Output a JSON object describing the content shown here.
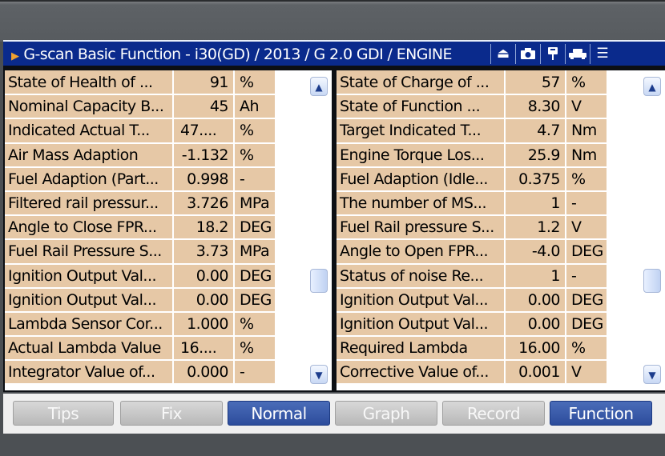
{
  "title": "G-scan Basic Function - i30(GD) / 2013 / G 2.0 GDI / ENGINE",
  "toolbar_icons": [
    "eject-icon",
    "camera-icon",
    "flag-icon",
    "car-icon",
    "menu-icon"
  ],
  "left_rows": [
    {
      "name": "State of Health of ...",
      "value": "91",
      "unit": "%"
    },
    {
      "name": "Nominal Capacity B...",
      "value": "45",
      "unit": "Ah"
    },
    {
      "name": "Indicated Actual T...",
      "value": "47....",
      "unit": "%"
    },
    {
      "name": "Air Mass Adaption",
      "value": "-1.132",
      "unit": "%"
    },
    {
      "name": "Fuel Adaption (Part...",
      "value": "0.998",
      "unit": "-"
    },
    {
      "name": "Filtered rail pressur...",
      "value": "3.726",
      "unit": "MPa"
    },
    {
      "name": "Angle to Close FPR...",
      "value": "18.2",
      "unit": "DEG"
    },
    {
      "name": "Fuel Rail Pressure S...",
      "value": "3.73",
      "unit": "MPa"
    },
    {
      "name": "Ignition Output Val...",
      "value": "0.00",
      "unit": "DEG"
    },
    {
      "name": "Ignition Output Val...",
      "value": "0.00",
      "unit": "DEG"
    },
    {
      "name": "Lambda Sensor Cor...",
      "value": "1.000",
      "unit": "%"
    },
    {
      "name": "Actual Lambda Value",
      "value": "16....",
      "unit": "%"
    },
    {
      "name": "Integrator Value of...",
      "value": "0.000",
      "unit": "-"
    }
  ],
  "right_rows": [
    {
      "name": "State of Charge of ...",
      "value": "57",
      "unit": "%"
    },
    {
      "name": "State of Function ...",
      "value": "8.30",
      "unit": "V"
    },
    {
      "name": "Target Indicated T...",
      "value": "4.7",
      "unit": "Nm"
    },
    {
      "name": "Engine Torque Los...",
      "value": "25.9",
      "unit": "Nm"
    },
    {
      "name": "Fuel Adaption (Idle...",
      "value": "0.375",
      "unit": "%"
    },
    {
      "name": "The number of MS...",
      "value": "1",
      "unit": "-"
    },
    {
      "name": "Fuel Rail pressure S...",
      "value": "1.2",
      "unit": "V"
    },
    {
      "name": "Angle to Open FPR...",
      "value": "-4.0",
      "unit": "DEG"
    },
    {
      "name": "Status of noise Re...",
      "value": "1",
      "unit": "-"
    },
    {
      "name": "Ignition Output Val...",
      "value": "0.00",
      "unit": "DEG"
    },
    {
      "name": "Ignition Output Val...",
      "value": "0.00",
      "unit": "DEG"
    },
    {
      "name": "Required Lambda",
      "value": "16.00",
      "unit": "%"
    },
    {
      "name": "Corrective Value of...",
      "value": "0.001",
      "unit": "V"
    }
  ],
  "bottom_buttons": [
    {
      "label": "Tips",
      "active": false
    },
    {
      "label": "Fix",
      "active": false
    },
    {
      "label": "Normal",
      "active": true
    },
    {
      "label": "Graph",
      "active": false
    },
    {
      "label": "Record",
      "active": false
    },
    {
      "label": "Function",
      "active": true
    }
  ],
  "colors": {
    "titlebar": "#0a2a8c",
    "row_bg": "#e6c8a6",
    "button_active": "#2c4c9c",
    "button_inactive": "#c4c4c4"
  }
}
